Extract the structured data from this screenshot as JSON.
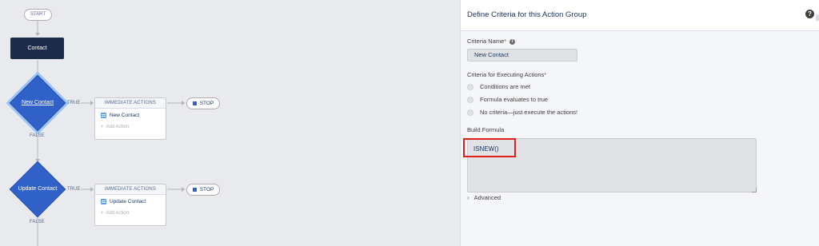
{
  "flow": {
    "start_label": "START",
    "object_label": "Contact",
    "criteria": [
      {
        "name": "New Contact",
        "true_label": "TRUE",
        "false_label": "FALSE",
        "actions_header": "IMMEDIATE ACTIONS",
        "action_item": "New Contact",
        "add_action": "Add Action",
        "stop_label": "STOP"
      },
      {
        "name": "Update Contact",
        "true_label": "TRUE",
        "false_label": "FALSE",
        "actions_header": "IMMEDIATE ACTIONS",
        "action_item": "Update Contact",
        "add_action": "Add Action",
        "stop_label": "STOP"
      }
    ]
  },
  "panel": {
    "title": "Define Criteria for this Action Group",
    "help_glyph": "?",
    "criteria_name_label": "Criteria Name",
    "required_mark": "*",
    "info_glyph": "i",
    "criteria_name_value": "New Contact",
    "executing_label": "Criteria for Executing Actions",
    "options": [
      "Conditions are met",
      "Formula evaluates to true",
      "No criteria—just execute the actions!"
    ],
    "build_formula_label": "Build Formula",
    "formula_value": "ISNEW()",
    "advanced_label": "Advanced"
  },
  "colors": {
    "canvas_bg": "#e9eaed",
    "object_box": "#1c2b4a",
    "diamond": "#2f61c8",
    "highlight": "#e0201b"
  }
}
